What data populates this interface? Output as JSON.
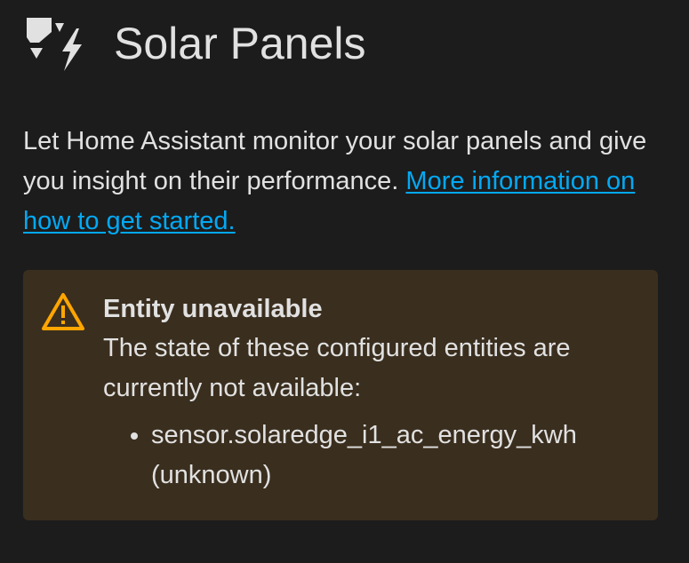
{
  "header": {
    "icon": "solar-power-icon",
    "title": "Solar Panels"
  },
  "description": {
    "text": "Let Home Assistant monitor your solar panels and give you insight on their performance. ",
    "link_text": "More information on how to get started."
  },
  "alert": {
    "icon": "alert-triangle-icon",
    "title": "Entity unavailable",
    "message": "The state of these configured entities are currently not available:",
    "entities": [
      "sensor.solaredge_i1_ac_energy_kwh (unknown)"
    ]
  },
  "colors": {
    "background": "#1c1c1c",
    "text": "#e1e1e1",
    "link": "#03a9f4",
    "warning": "#ffa600",
    "alert_background": "#3a2e1e"
  }
}
